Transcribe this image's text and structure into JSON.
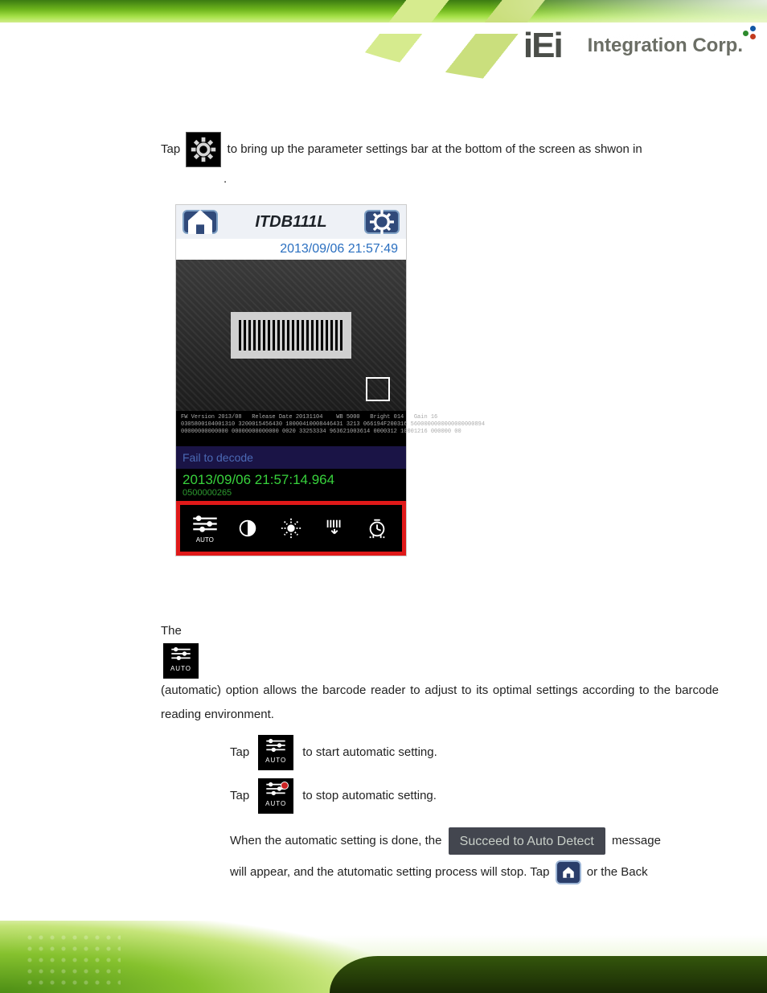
{
  "header": {
    "logo_mark": "iEi",
    "logo_tagline": "Integration Corp."
  },
  "body": {
    "p1_a": "Tap ",
    "p1_b": " to bring up the parameter settings bar at the bottom of the screen as shwon in",
    "p1_c": ".",
    "shot": {
      "title": "ITDB111L",
      "clock": "2013/09/06 21:57:49",
      "fail": "Fail to decode",
      "succ_time": "2013/09/06 21:57:14.964",
      "succ_code": "0500000265",
      "icon_auto_label": "AUTO"
    },
    "p2_a": "The ",
    "p2_b": " (automatic) option allows the barcode reader to adjust to its optimal settings according to the barcode reading environment.",
    "step1_a": "Tap ",
    "step1_b": " to start automatic setting.",
    "step2_a": "Tap ",
    "step2_b": " to stop automatic setting.",
    "step3_a": "When the automatic setting is done, the ",
    "succeed_pill": "Succeed to Auto Detect",
    "step3_b": " message",
    "step3_c": "will appear, and the atutomatic setting process will stop. Tap ",
    "step3_d": " or the Back",
    "auto_label": "AUTO"
  }
}
